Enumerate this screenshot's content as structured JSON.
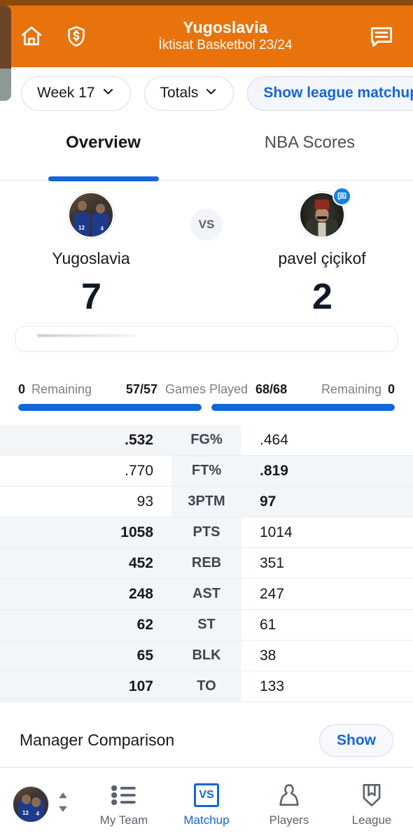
{
  "header": {
    "title": "Yugoslavia",
    "subtitle": "İktisat Basketbol 23/24",
    "home_icon": "home-icon",
    "shield_dollar_icon": "shield-dollar-icon",
    "message_icon": "message-icon",
    "background_color": "#e8730c"
  },
  "filters": {
    "week": "Week 17",
    "scoring": "Totals",
    "league_matchup": "Show league matchup",
    "link_color": "#1565d8"
  },
  "tabs": [
    {
      "label": "Overview",
      "active": true
    },
    {
      "label": "NBA Scores",
      "active": false
    }
  ],
  "matchup": {
    "vs_label": "VS",
    "home": {
      "name": "Yugoslavia",
      "score": "7",
      "avatar": "team-photo-avatar"
    },
    "away": {
      "name": "pavel çiçikof",
      "score": "2",
      "avatar": "fez-man-avatar",
      "badge": "chat-badge"
    }
  },
  "games_played": {
    "center_label": "Games Played",
    "left_remaining_label": "Remaining",
    "left_remaining_value": "0",
    "left_played": "57/57",
    "right_played": "68/68",
    "right_remaining_label": "Remaining",
    "right_remaining_value": "0",
    "left_progress_percent": 100,
    "right_progress_percent": 100,
    "bar_color": "#1166d8"
  },
  "stats": {
    "rows": [
      {
        "label": "FG%",
        "left": ".532",
        "right": ".464",
        "winner": "left"
      },
      {
        "label": "FT%",
        "left": ".770",
        "right": ".819",
        "winner": "right"
      },
      {
        "label": "3PTM",
        "left": "93",
        "right": "97",
        "winner": "right"
      },
      {
        "label": "PTS",
        "left": "1058",
        "right": "1014",
        "winner": "left"
      },
      {
        "label": "REB",
        "left": "452",
        "right": "351",
        "winner": "left"
      },
      {
        "label": "AST",
        "left": "248",
        "right": "247",
        "winner": "left"
      },
      {
        "label": "ST",
        "left": "62",
        "right": "61",
        "winner": "left"
      },
      {
        "label": "BLK",
        "left": "65",
        "right": "38",
        "winner": "left"
      },
      {
        "label": "TO",
        "left": "107",
        "right": "133",
        "winner": "left"
      }
    ]
  },
  "manager_comparison": {
    "title": "Manager Comparison",
    "button_label": "Show"
  },
  "bottom_nav": {
    "team_switch_icon": "up-down-arrows-icon",
    "team_switch_avatar": "team-photo-avatar",
    "items": [
      {
        "label": "My Team",
        "icon": "list-icon",
        "active": false
      },
      {
        "label": "Matchup",
        "icon": "vs-box-icon",
        "active": true
      },
      {
        "label": "Players",
        "icon": "person-icon",
        "active": false
      },
      {
        "label": "League",
        "icon": "trophy-shield-icon",
        "active": false
      }
    ],
    "active_color": "#1166d8"
  }
}
